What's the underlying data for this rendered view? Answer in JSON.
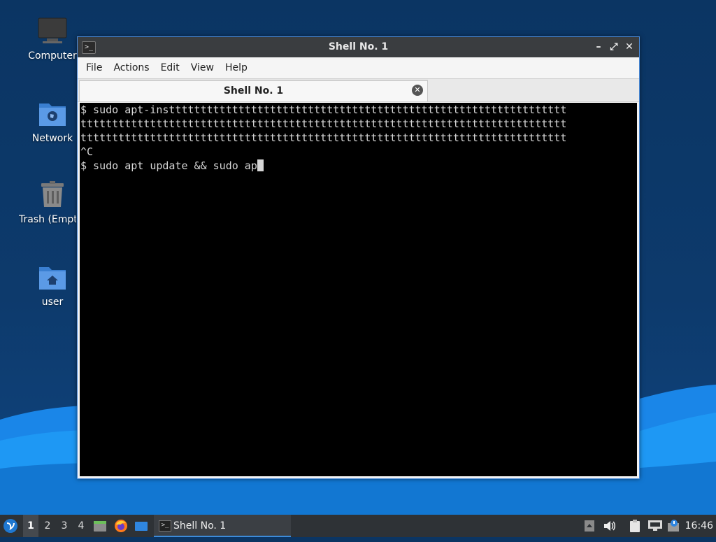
{
  "desktop": {
    "icons": [
      {
        "label": "Computer"
      },
      {
        "label": "Network"
      },
      {
        "label": "Trash (Empty)"
      },
      {
        "label": "user"
      }
    ]
  },
  "window": {
    "title": "Shell No. 1",
    "menu": [
      "File",
      "Actions",
      "Edit",
      "View",
      "Help"
    ],
    "tab_label": "Shell No. 1",
    "terminal_lines": [
      "$ sudo apt-insttttttttttttttttttttttttttttttttttttttttttttttttttttttttttttttt",
      "ttttttttttttttttttttttttttttttttttttttttttttttttttttttttttttttttttttttttttttt",
      "ttttttttttttttttttttttttttttttttttttttttttttttttttttttttttttttttttttttttttttt",
      "^C",
      "$ sudo apt update && sudo ap"
    ]
  },
  "taskbar": {
    "workspaces": [
      "1",
      "2",
      "3",
      "4"
    ],
    "active_workspace": "1",
    "task_label": "Shell No. 1",
    "clock": "16:46"
  },
  "colors": {
    "accent": "#3d8bd9",
    "titlebar": "#3a3d40",
    "terminal_bg": "#000000",
    "terminal_fg": "#d6d6d6"
  }
}
